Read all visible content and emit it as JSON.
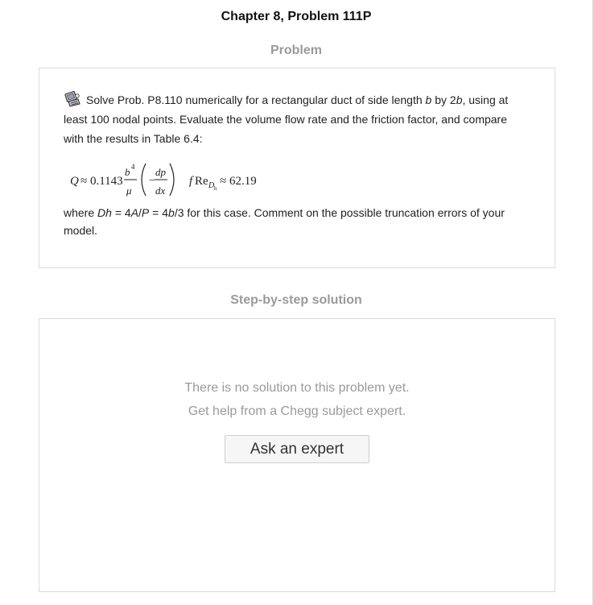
{
  "header": {
    "title": "Chapter 8, Problem 111P"
  },
  "problem": {
    "heading": "Problem",
    "icon": "computer-icon",
    "text_a": "Solve Prob. P8.110 numerically for a rectangular duct of  side length ",
    "var_b": "b",
    "text_b": " by 2",
    "text_c": ", using at least 100 nodal points. Evaluate the volume flow rate and the friction factor, and compare with the results in Table 6.4:",
    "eq": {
      "Q": "Q",
      "approx1": "≈ 0.1143",
      "num": "b",
      "pow": "4",
      "den": "μ",
      "minus": "−",
      "dp": "dp",
      "dx": "dx",
      "f": "f",
      "Re": "Re",
      "subD": "D",
      "subh": "h",
      "approx2": "≈ 62.19"
    },
    "w_where": "where ",
    "w_Dh": "Dh",
    "w_eq1": " = 4",
    "w_A": "A",
    "w_slash": "/",
    "w_P": "P",
    "w_eq2": " = 4",
    "w_b": "b",
    "w_tail": "/3 for this case. Comment on the possible truncation errors of your model."
  },
  "solution": {
    "heading": "Step-by-step solution",
    "empty_line1": "There is no solution to this problem yet.",
    "empty_line2": "Get help from a Chegg subject expert.",
    "button_label": "Ask an expert"
  }
}
